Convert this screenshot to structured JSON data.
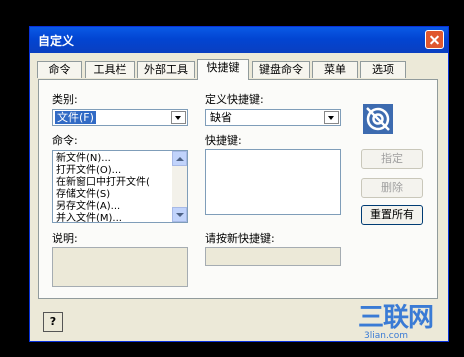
{
  "window": {
    "title": "自定义"
  },
  "tabs": [
    {
      "label": "命令"
    },
    {
      "label": "工具栏"
    },
    {
      "label": "外部工具"
    },
    {
      "label": "快捷键"
    },
    {
      "label": "键盘命令"
    },
    {
      "label": "菜单"
    },
    {
      "label": "选项"
    }
  ],
  "active_tab": "快捷键",
  "category": {
    "label": "类别:",
    "value": "文件(F)"
  },
  "commands": {
    "label": "命令:",
    "items": [
      "新文件(N)...",
      "打开文件(O)...",
      "在新窗口中打开文件(",
      "存储文件(S)",
      "另存文件(A)...",
      "并入文件(M)..."
    ]
  },
  "description": {
    "label": "说明:"
  },
  "define_shortcut": {
    "label": "定义快捷键:",
    "value": "缺省"
  },
  "shortcuts": {
    "label": "快捷键:"
  },
  "new_shortcut": {
    "label": "请按新快捷键:"
  },
  "buttons": {
    "assign": "指定",
    "delete": "删除",
    "reset_all": "重置所有"
  },
  "help_button": "?",
  "watermark": {
    "text": "三联网",
    "url": "3lian.com"
  }
}
